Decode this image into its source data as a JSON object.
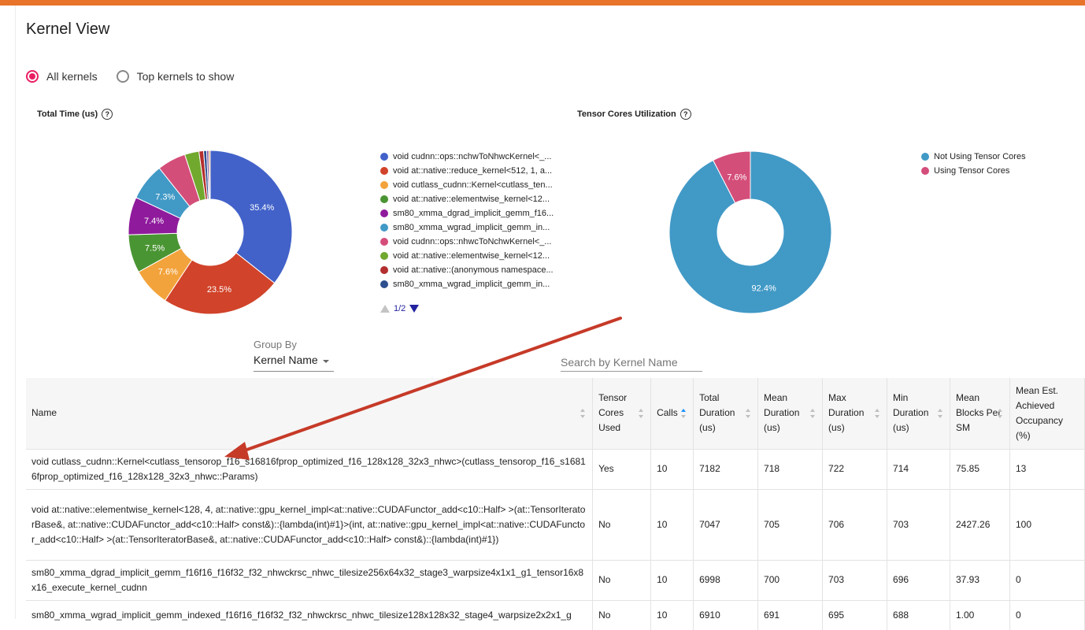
{
  "title": "Kernel View",
  "view_options": [
    {
      "label": "All kernels",
      "checked": true
    },
    {
      "label": "Top kernels to show",
      "checked": false
    }
  ],
  "total_time": {
    "title": "Total Time (us)",
    "help": "?",
    "legend": [
      "void cudnn::ops::nchwToNhwcKernel<_...",
      "void at::native::reduce_kernel<512, 1, a...",
      "void cutlass_cudnn::Kernel<cutlass_ten...",
      "void at::native::elementwise_kernel<12...",
      "sm80_xmma_dgrad_implicit_gemm_f16...",
      "sm80_xmma_wgrad_implicit_gemm_in...",
      "void cudnn::ops::nhwcToNchwKernel<_...",
      "void at::native::elementwise_kernel<12...",
      "void at::native::(anonymous namespace...",
      "sm80_xmma_wgrad_implicit_gemm_in..."
    ],
    "pager": "1/2"
  },
  "tensor_cores": {
    "title": "Tensor Cores Utilization",
    "help": "?",
    "legend": [
      "Not Using Tensor Cores",
      "Using Tensor Cores"
    ]
  },
  "chart_data": [
    {
      "type": "pie",
      "title": "Total Time (us)",
      "donut": true,
      "slice_labels": [
        "35.4%",
        "23.5%",
        "7.6%",
        "7.5%",
        "7.4%",
        "7.3%",
        "",
        "",
        "",
        "",
        "",
        ""
      ],
      "values": [
        35.4,
        23.5,
        7.6,
        7.5,
        7.4,
        7.3,
        5.6,
        2.8,
        0.9,
        0.6,
        0.4,
        0.3
      ],
      "colors": [
        "#4262c9",
        "#d1432a",
        "#f3a33b",
        "#4a9533",
        "#8f1b9c",
        "#4199c6",
        "#d44e7a",
        "#71a82e",
        "#b32e2e",
        "#2d4f8e",
        "#7a4ea3",
        "#e08a3c"
      ]
    },
    {
      "type": "pie",
      "title": "Tensor Cores Utilization",
      "donut": true,
      "categories": [
        "Not Using Tensor Cores",
        "Using Tensor Cores"
      ],
      "values": [
        92.4,
        7.6
      ],
      "slice_labels": [
        "92.4%",
        "7.6%"
      ],
      "colors": [
        "#4199c6",
        "#d44e7a"
      ]
    }
  ],
  "group_by": {
    "label": "Group By",
    "value": "Kernel Name"
  },
  "search": {
    "placeholder": "Search by Kernel Name"
  },
  "table": {
    "columns": [
      {
        "key": "name",
        "label": "Name"
      },
      {
        "key": "tc",
        "label": "Tensor Cores Used"
      },
      {
        "key": "calls",
        "label": "Calls"
      },
      {
        "key": "total",
        "label": "Total Duration (us)"
      },
      {
        "key": "mean",
        "label": "Mean Duration (us)"
      },
      {
        "key": "max",
        "label": "Max Duration (us)"
      },
      {
        "key": "min",
        "label": "Min Duration (us)"
      },
      {
        "key": "blocks",
        "label": "Mean Blocks Per SM"
      },
      {
        "key": "occ",
        "label": "Mean Est. Achieved Occupancy (%)"
      }
    ],
    "rows": [
      {
        "name": "void cutlass_cudnn::Kernel<cutlass_tensorop_f16_s16816fprop_optimized_f16_128x128_32x3_nhwc>(cutlass_tensorop_f16_s16816fprop_optimized_f16_128x128_32x3_nhwc::Params)",
        "tc": "Yes",
        "calls": "10",
        "total": "7182",
        "mean": "718",
        "max": "722",
        "min": "714",
        "blocks": "75.85",
        "occ": "13"
      },
      {
        "name": "void at::native::elementwise_kernel<128, 4, at::native::gpu_kernel_impl<at::native::CUDAFunctor_add<c10::Half> >(at::TensorIteratorBase&, at::native::CUDAFunctor_add<c10::Half> const&)::{lambda(int)#1}>(int, at::native::gpu_kernel_impl<at::native::CUDAFunctor_add<c10::Half> >(at::TensorIteratorBase&, at::native::CUDAFunctor_add<c10::Half> const&)::{lambda(int)#1})",
        "tc": "No",
        "calls": "10",
        "total": "7047",
        "mean": "705",
        "max": "706",
        "min": "703",
        "blocks": "2427.26",
        "occ": "100"
      },
      {
        "name": "sm80_xmma_dgrad_implicit_gemm_f16f16_f16f32_f32_nhwckrsc_nhwc_tilesize256x64x32_stage3_warpsize4x1x1_g1_tensor16x8x16_execute_kernel_cudnn",
        "tc": "No",
        "calls": "10",
        "total": "6998",
        "mean": "700",
        "max": "703",
        "min": "696",
        "blocks": "37.93",
        "occ": "0"
      },
      {
        "name": "sm80_xmma_wgrad_implicit_gemm_indexed_f16f16_f16f32_f32_nhwckrsc_nhwc_tilesize128x128x32_stage4_warpsize2x2x1_g",
        "tc": "No",
        "calls": "10",
        "total": "6910",
        "mean": "691",
        "max": "695",
        "min": "688",
        "blocks": "1.00",
        "occ": "0"
      }
    ]
  }
}
